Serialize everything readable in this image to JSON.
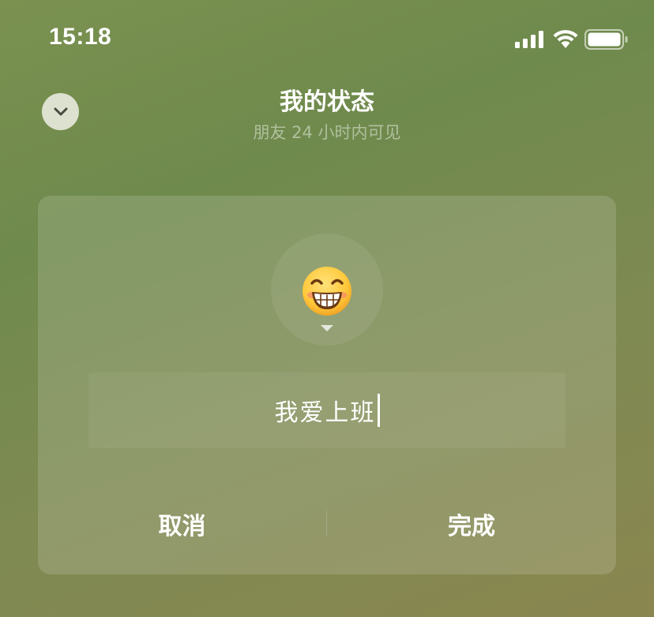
{
  "status_bar": {
    "time": "15:18",
    "signal_icon": "cellular-signal-icon",
    "wifi_icon": "wifi-icon",
    "battery_icon": "battery-icon"
  },
  "header": {
    "collapse_icon": "chevron-down-icon",
    "title": "我的状态",
    "subtitle": "朋友 24 小时内可见"
  },
  "editor": {
    "emoji_icon": "grinning-face-emoji",
    "emoji_picker_icon": "caret-down-icon",
    "input_value": "我爱上班"
  },
  "actions": {
    "cancel_label": "取消",
    "done_label": "完成"
  }
}
